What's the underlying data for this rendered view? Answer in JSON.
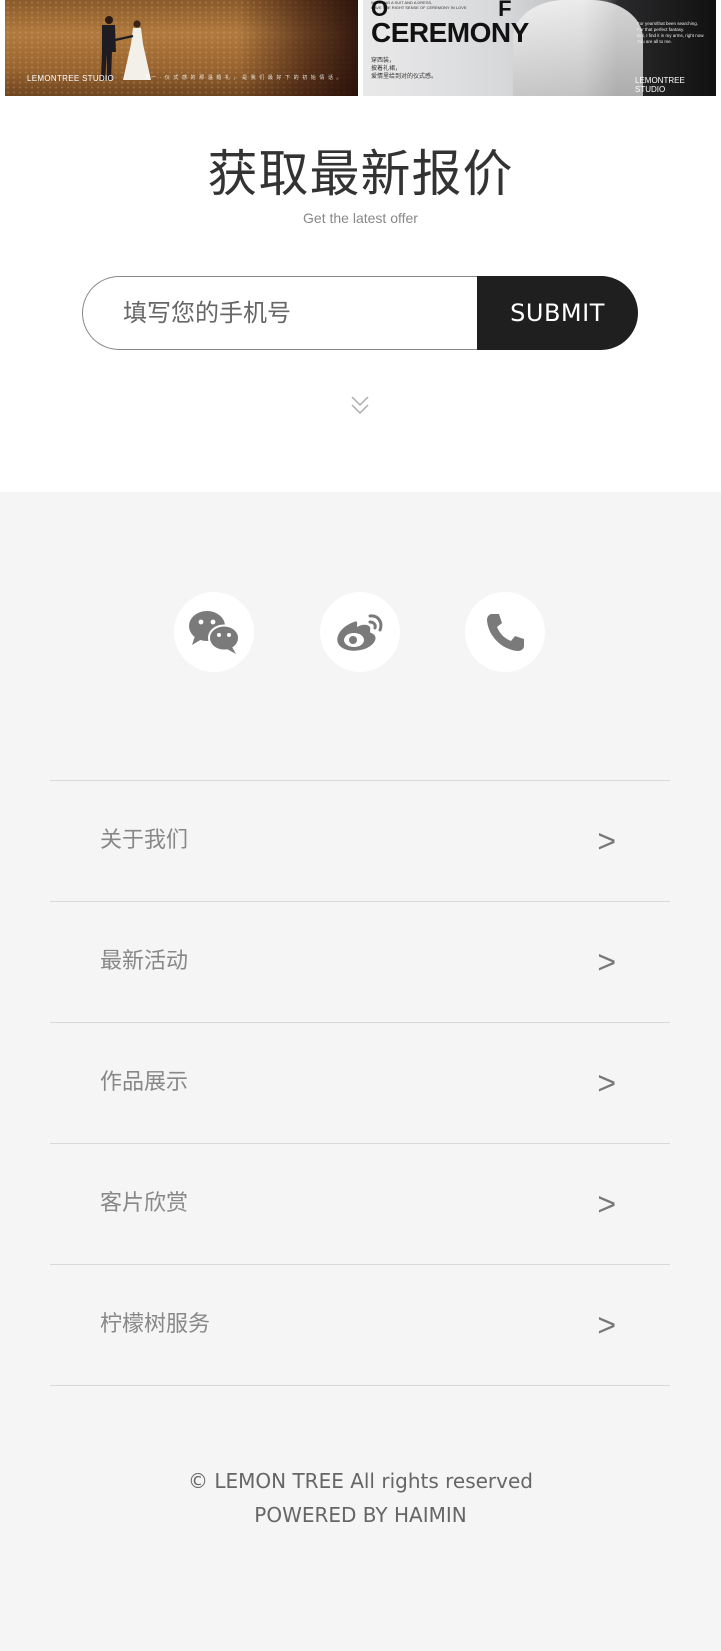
{
  "banner": {
    "left": {
      "brand": "LEMONTREE STUDIO",
      "caption": "再一 · 仪 式 感 的 那 温 婚 礼 ， 是 我 们 最 好 下 的 初 始 情 话 。"
    },
    "right": {
      "small_text_1": "WEARING A SUIT AND A DRESS,",
      "small_text_2": "HAVE THE RIGHT SENSE OF CEREMONY IN LOVE",
      "letter_o": "O",
      "letter_f": "F",
      "headline": "CEREMONY",
      "cn_line_1": "穿西装，",
      "cn_line_2": "披着礼裙，",
      "cn_line_3": "爱情里给到对的仪式感。",
      "quote_1": "For years/that been searching.",
      "quote_2": "For that perfect fantasy.",
      "quote_3": "But, I find it in my arms, right now.",
      "quote_4": "You are all to me.",
      "brand": "LEMONTREE STUDIO"
    }
  },
  "offer": {
    "title": "获取最新报价",
    "subtitle": "Get the latest offer",
    "input_placeholder": "填写您的手机号",
    "submit_label": "SUBMIT"
  },
  "icons": {
    "scroll_down": "chevron-double-down-icon",
    "social": [
      "wechat-icon",
      "weibo-icon",
      "phone-icon"
    ]
  },
  "colors": {
    "footer_bg": "#f5f5f5",
    "submit_bg": "#1f1f1f",
    "icon_gray": "#7a7a7a"
  },
  "menu": {
    "items": [
      {
        "label": "关于我们",
        "arrow": ">"
      },
      {
        "label": "最新活动",
        "arrow": ">"
      },
      {
        "label": "作品展示",
        "arrow": ">"
      },
      {
        "label": "客片欣赏",
        "arrow": ">"
      },
      {
        "label": "柠檬树服务",
        "arrow": ">"
      }
    ]
  },
  "footer": {
    "copyright": "© LEMON TREE All rights reserved",
    "powered_by": "POWERED BY HAIMIN"
  }
}
